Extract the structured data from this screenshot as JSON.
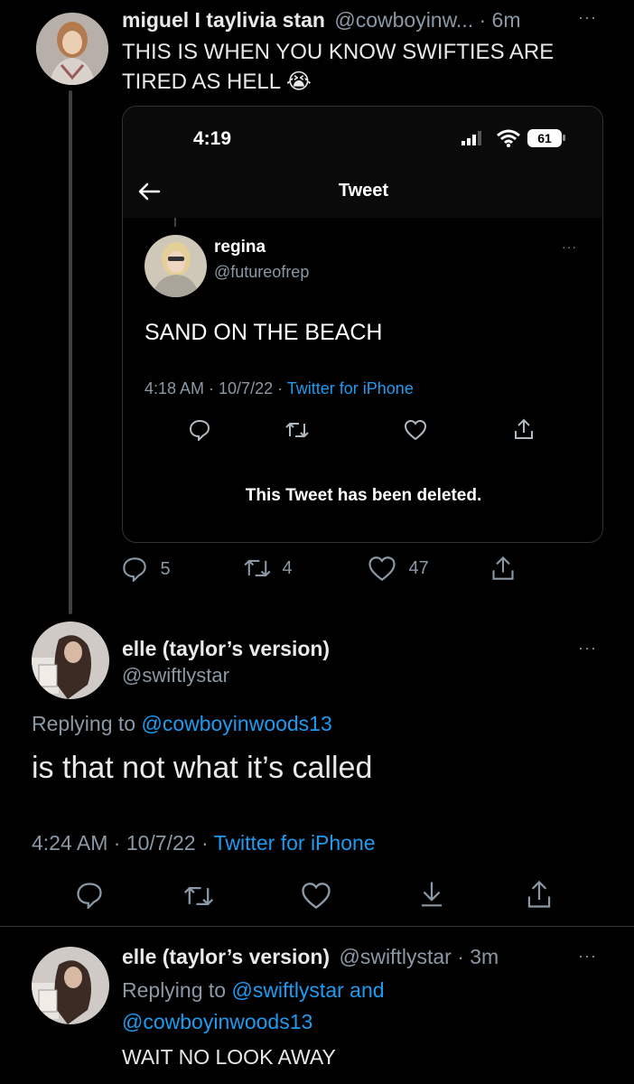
{
  "tweet1": {
    "name": "miguel I taylivia stan",
    "handle": "@cowboyinw...",
    "time": "· 6m",
    "text": "THIS IS WHEN YOU KNOW SWIFTIES ARE TIRED AS HELL",
    "emoji": "😭",
    "embedded_screenshot": {
      "status_time": "4:19",
      "battery": "61",
      "nav_title": "Tweet",
      "inner_tweet": {
        "name": "regina",
        "handle": "@futureofrep",
        "text": "SAND ON THE BEACH",
        "timestamp": "4:18 AM · 10/7/22 · ",
        "source": "Twitter for iPhone"
      },
      "deleted_notice": "This Tweet has been deleted."
    },
    "stats": {
      "replies": "5",
      "retweets": "4",
      "likes": "47"
    }
  },
  "tweet2": {
    "name": "elle (taylor’s version)",
    "handle": "@swiftlystar",
    "replying_prefix": "Replying to ",
    "replying_to": "@cowboyinwoods13",
    "text": "is that not what it’s called",
    "timestamp": "4:24 AM · 10/7/22 · ",
    "source": "Twitter for iPhone"
  },
  "tweet3": {
    "name": "elle (taylor’s version)",
    "handle": "@swiftlystar",
    "time": "· 3m",
    "replying_prefix": "Replying to ",
    "replying_to": "@swiftlystar and",
    "replying_to_2": "@cowboyinwoods13",
    "text": "WAIT NO LOOK AWAY"
  },
  "more_icon": "···",
  "colors": {
    "background": "#000000",
    "text": "#e7e9ea",
    "muted": "#8b98a5",
    "link": "#1d9bf0",
    "battery_bg": "#ffffff"
  }
}
